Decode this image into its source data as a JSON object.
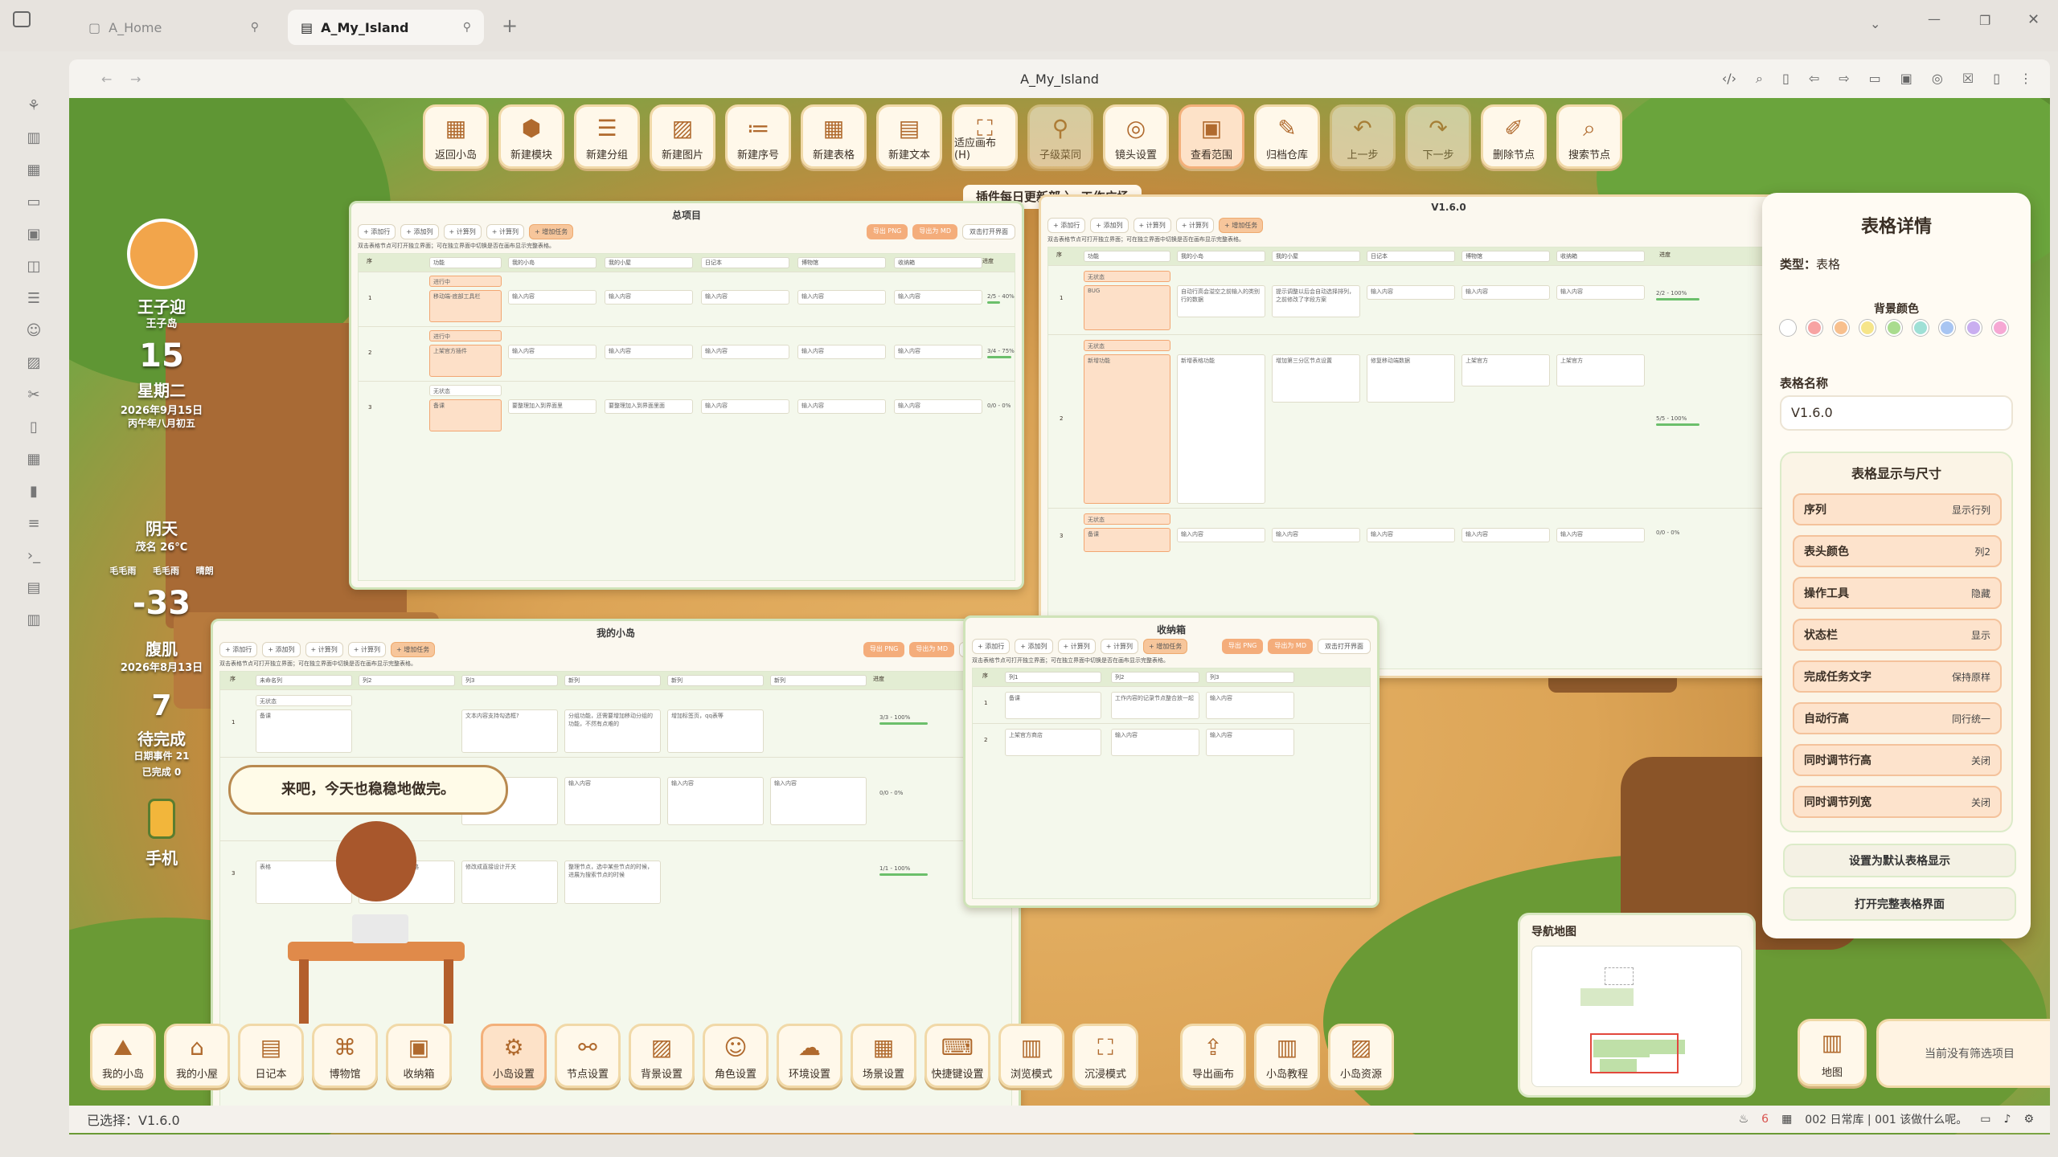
{
  "tabs": [
    {
      "label": "A_Home"
    },
    {
      "label": "A_My_Island"
    }
  ],
  "navbar": {
    "title": "A_My_Island"
  },
  "top_tools": [
    {
      "label": "返回小岛",
      "icon": "grid-icon"
    },
    {
      "label": "新建模块",
      "icon": "cube-icon"
    },
    {
      "label": "新建分组",
      "icon": "list-icon"
    },
    {
      "label": "新建图片",
      "icon": "image-icon"
    },
    {
      "label": "新建序号",
      "icon": "numbered-list-icon"
    },
    {
      "label": "新建表格",
      "icon": "table-icon"
    },
    {
      "label": "新建文本",
      "icon": "document-icon"
    },
    {
      "label": "适应画布 (H)",
      "icon": "fit-icon"
    },
    {
      "label": "子级菜同",
      "icon": "tree-icon"
    },
    {
      "label": "镜头设置",
      "icon": "target-icon"
    },
    {
      "label": "查看范围",
      "icon": "range-icon"
    },
    {
      "label": "归档仓库",
      "icon": "pencil-icon"
    },
    {
      "label": "上一步",
      "icon": "undo-icon"
    },
    {
      "label": "下一步",
      "icon": "redo-icon"
    },
    {
      "label": "删除节点",
      "icon": "pen-delete-icon"
    },
    {
      "label": "搜索节点",
      "icon": "search-icon"
    }
  ],
  "breadcrumb": {
    "path": "插件每日更新部 〉 工作广场"
  },
  "profile": {
    "name": "王子迎",
    "sub": "王子岛",
    "day": "15",
    "weekday": "星期二",
    "date": "2026年9月15日",
    "lunar": "丙午年八月初五",
    "weather": "阴天",
    "temp": "茂名 26°C",
    "w1": "毛毛雨",
    "w2": "毛毛雨",
    "w3": "晴朗",
    "count": "-33",
    "count_label": "腹肌",
    "count_date": "2026年8月13日",
    "todo": "7",
    "todo_label": "待完成",
    "events": "日期事件 21",
    "done": "已完成 0",
    "phone": "手机"
  },
  "speech": {
    "text": "来吧，今天也稳稳地做完。"
  },
  "common": {
    "ops": [
      "+ 添加行",
      "+ 添加列",
      "+ 计算列",
      "+ 计算列",
      "+ 增加任务"
    ],
    "rops": [
      "导出 PNG",
      "导出为 MD",
      "双击打开界面"
    ],
    "hint": "双击表格节点可打开独立界面；可在独立界面中切换是否在画布显示完整表格。",
    "input": "输入内容",
    "nostatus": "无状态"
  },
  "card1": {
    "title": "总项目",
    "cols": [
      "序",
      "功能",
      "我的小岛",
      "我的小屋",
      "日记本",
      "博物馆",
      "收纳箱",
      "进度"
    ],
    "rows": [
      {
        "n": "1",
        "status": "进行中",
        "task": "移动端-底部工具栏",
        "progress": "2/5 - 40%",
        "pct": 0.4
      },
      {
        "n": "2",
        "status": "进行中",
        "task": "上架官方插件",
        "progress": "3/4 - 75%",
        "pct": 0.75
      },
      {
        "n": "3",
        "status": "无状态",
        "task": "备课",
        "c1": "要整理加入到界面里",
        "c2": "要整理加入到界面里面",
        "progress": "0/0 - 0%",
        "pct": 0
      }
    ]
  },
  "card2": {
    "title": "V1.6.0",
    "cols": [
      "序",
      "功能",
      "我的小岛",
      "我的小屋",
      "日记本",
      "博物馆",
      "收纳箱",
      "进度"
    ],
    "rows": [
      {
        "n": "1",
        "task": "BUG",
        "c1": "自动行高会溢空之前输入的类别行的数据",
        "c2": "提示调整以后会自动选择排列，之前修改了字段方案",
        "progress": "2/2 - 100%",
        "pct": 1
      },
      {
        "n": "2",
        "task": "新增功能",
        "c1": "新增表格功能",
        "c2": "增加第三分区节点设置",
        "c3": "修复移动端数据",
        "c4": "上架官方",
        "c5": "上架官方",
        "progress": "5/5 - 100%",
        "pct": 1
      },
      {
        "n": "3",
        "task": "备课",
        "progress": "0/0 - 0%",
        "pct": 0
      }
    ]
  },
  "card3": {
    "title": "我的小岛",
    "cols": [
      "序",
      "未命名列",
      "列2",
      "列3",
      "新列",
      "新列",
      "新列",
      "进度"
    ],
    "rows": [
      {
        "n": "1",
        "task": "备课",
        "c1": "文本内容支持勾选框?",
        "c2": "分组功能，还需要增加移动分组的功能，不然有点难的",
        "c3": "增加标签页，qq表等",
        "progress": "3/3 - 100%",
        "pct": 1
      },
      {
        "n": "2",
        "progress": "0/0 - 0%",
        "pct": 0
      },
      {
        "n": "3",
        "task": "表格",
        "c2": "自定义为默认新建表格",
        "c3": "修改成直接设计开关",
        "c4": "整理节点，选中某些节点的时候，进展为搜索节点的时候",
        "progress": "1/1 - 100%",
        "pct": 1
      }
    ]
  },
  "card4": {
    "title": "收纳箱",
    "cols": [
      "序",
      "列1",
      "列2",
      "列3"
    ],
    "rows": [
      {
        "n": "1",
        "task": "备课",
        "c1": "工作内容的记录节点整合放一起"
      },
      {
        "n": "2",
        "task": "上架官方商店"
      }
    ]
  },
  "side": {
    "title": "表格详情",
    "type_label": "类型：",
    "type_value": "表格",
    "bg_label": "背景颜色",
    "name_label": "表格名称",
    "name_value": "V1.6.0",
    "size_label": "表格显示与尺寸",
    "options": [
      {
        "k": "序列",
        "v": "显示行列"
      },
      {
        "k": "表头颜色",
        "v": "列2"
      },
      {
        "k": "操作工具",
        "v": "隐藏"
      },
      {
        "k": "状态栏",
        "v": "显示"
      },
      {
        "k": "完成任务文字",
        "v": "保持原样"
      },
      {
        "k": "自动行高",
        "v": "同行统一"
      },
      {
        "k": "同时调节行高",
        "v": "关闭"
      },
      {
        "k": "同时调节列宽",
        "v": "关闭"
      }
    ],
    "btn1": "设置为默认表格显示",
    "btn2": "打开完整表格界面",
    "swatches": [
      "#ffffff",
      "#f7a3a3",
      "#f8c08e",
      "#f6e58a",
      "#a9dc8e",
      "#9fe0d6",
      "#a8c5f2",
      "#c9aef0",
      "#f6a8d4"
    ]
  },
  "bottom_tools": [
    {
      "label": "我的小岛",
      "icon": "island-icon"
    },
    {
      "label": "我的小屋",
      "icon": "house-icon"
    },
    {
      "label": "日记本",
      "icon": "diary-icon"
    },
    {
      "label": "博物馆",
      "icon": "museum-icon"
    },
    {
      "label": "收纳箱",
      "icon": "box-icon"
    },
    {
      "label": "小岛设置",
      "icon": "gear-icon"
    },
    {
      "label": "节点设置",
      "icon": "node-icon"
    },
    {
      "label": "背景设置",
      "icon": "picture-icon"
    },
    {
      "label": "角色设置",
      "icon": "character-icon"
    },
    {
      "label": "环境设置",
      "icon": "weather-icon"
    },
    {
      "label": "场景设置",
      "icon": "scene-icon"
    },
    {
      "label": "快捷键设置",
      "icon": "keyboard-icon"
    },
    {
      "label": "浏览模式",
      "icon": "map-fold-icon"
    },
    {
      "label": "沉浸模式",
      "icon": "focus-icon"
    },
    {
      "label": "导出画布",
      "icon": "export-icon"
    },
    {
      "label": "小岛教程",
      "icon": "book-icon"
    },
    {
      "label": "小岛资源",
      "icon": "resource-icon"
    }
  ],
  "minimap": {
    "title": "导航地图"
  },
  "map_button": {
    "label": "地图"
  },
  "filter": {
    "text": "当前没有筛选项目"
  },
  "status": {
    "selected": "已选择：V1.6.0",
    "right": "002 日常库 | 001 该做什么呢。",
    "badge": "6"
  }
}
